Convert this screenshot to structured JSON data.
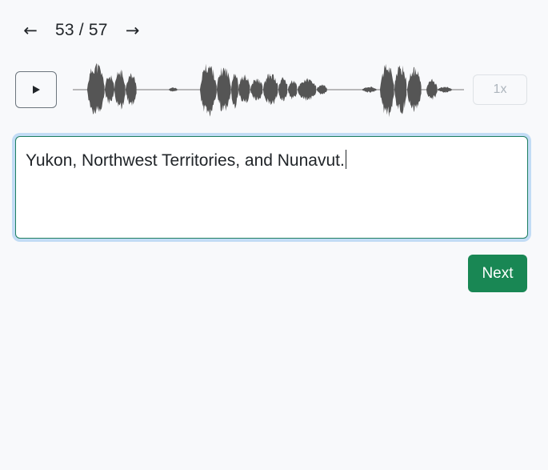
{
  "pager": {
    "prev_icon": "arrow-left-icon",
    "next_icon": "arrow-right-icon",
    "current": 53,
    "total": 57,
    "counter_text": "53 / 57"
  },
  "player": {
    "play_icon": "play-icon",
    "waveform_color": "#555555",
    "speed_label": "1x"
  },
  "transcript": {
    "value": "Yukon, Northwest Territories, and Nunavut."
  },
  "actions": {
    "next_label": "Next"
  },
  "colors": {
    "background": "#f8f9fb",
    "accent": "#198754",
    "focus_ring": "#c2dcf5",
    "text": "#212529"
  }
}
